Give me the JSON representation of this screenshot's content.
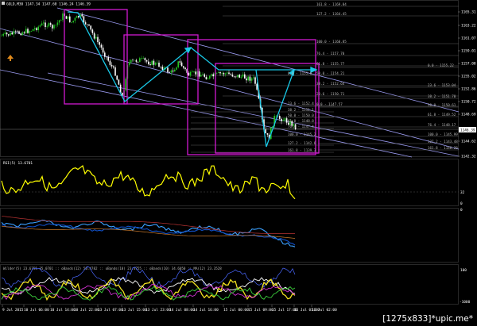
{
  "main_chart": {
    "header": "GOLD,M30  1147.34 1147.60 1146.24 1146.39",
    "price_labels": [
      "1165.31",
      "1163.22",
      "1161.07",
      "1159.01",
      "1157.08",
      "1155.02",
      "1152.86",
      "1150.72",
      "1148.69",
      "1146.39",
      "1144.62",
      "1142.32"
    ],
    "current_price": "1146.39",
    "fib_top": [
      {
        "label": "161.8 - 1169.04"
      },
      {
        "label": "127.2 - 1164.45"
      },
      {
        "label": "100.0 - 1160.85"
      },
      {
        "label": "76.4 - 1157.70"
      },
      {
        "label": "61.8 - 1155.77"
      },
      {
        "label": "50.0 - 1154.21"
      },
      {
        "label": "38.2 - 1152.64"
      },
      {
        "label": "23.6 - 1150.71"
      },
      {
        "label": "0.0 - 1147.57"
      }
    ],
    "fib_right": [
      {
        "label": "0.0 - 1155.22"
      },
      {
        "label": "23.6 - 1153.04"
      },
      {
        "label": "38.2 - 1151.70"
      },
      {
        "label": "50.0 - 1150.61"
      },
      {
        "label": "61.8 - 1149.52"
      },
      {
        "label": "76.4 - 1148.17"
      },
      {
        "label": "100.0 - 1145.99"
      },
      {
        "label": "127.2 - 1143.48"
      },
      {
        "label": "161.8 - 1140.28"
      }
    ],
    "fib_inner": [
      {
        "label": "0.0 - 1155.0"
      },
      {
        "label": "23.6 - 1152.4"
      },
      {
        "label": "38.2 - 1151.1"
      },
      {
        "label": "50.0 - 1150.0"
      },
      {
        "label": "61.8 - 1148.8"
      },
      {
        "label": "76.4 - 1147.4"
      },
      {
        "label": "100.0 - 1145.2"
      },
      {
        "label": "127.2 - 1142.6"
      },
      {
        "label": "161.8 - 1139.3"
      }
    ]
  },
  "rsi_panel": {
    "header": "RSI(5) 13.6701",
    "levels": [
      "32",
      "0"
    ]
  },
  "macd_panel": {
    "scale": [
      "0"
    ]
  },
  "adx_panel": {
    "header": "Wilder(5) 23.6755 35.0701 :: oBands(12) 50.4782 :: oBands(10) 23.4755 :: oBands(10) 34.6050 :: MA(12) 23.3528",
    "levels": [
      "100",
      "-1000"
    ]
  },
  "time_axis": {
    "labels": [
      "9 Jul 2015",
      "10 Jul 06:00",
      "10 Jul 14:00",
      "10 Jul 22:00",
      "13 Jul 07:00",
      "13 Jul 15:00",
      "13 Jul 23:00",
      "14 Jul 08:00",
      "14 Jul 16:00",
      "15 Jul 00:00",
      "15 Jul 09:00",
      "15 Jul 17:00",
      "16 Jul 01:00",
      "16 Jul 02:00"
    ]
  },
  "watermark": "[1275x833]*upic.me*",
  "colors": {
    "bull": "#22c422",
    "bear": "#ffffff",
    "magenta_box": "#d218d2",
    "cyan": "#19c8e6",
    "channel": "#a8a8f0",
    "rsi": "#ffff00",
    "signal": "#3aa0ff"
  }
}
